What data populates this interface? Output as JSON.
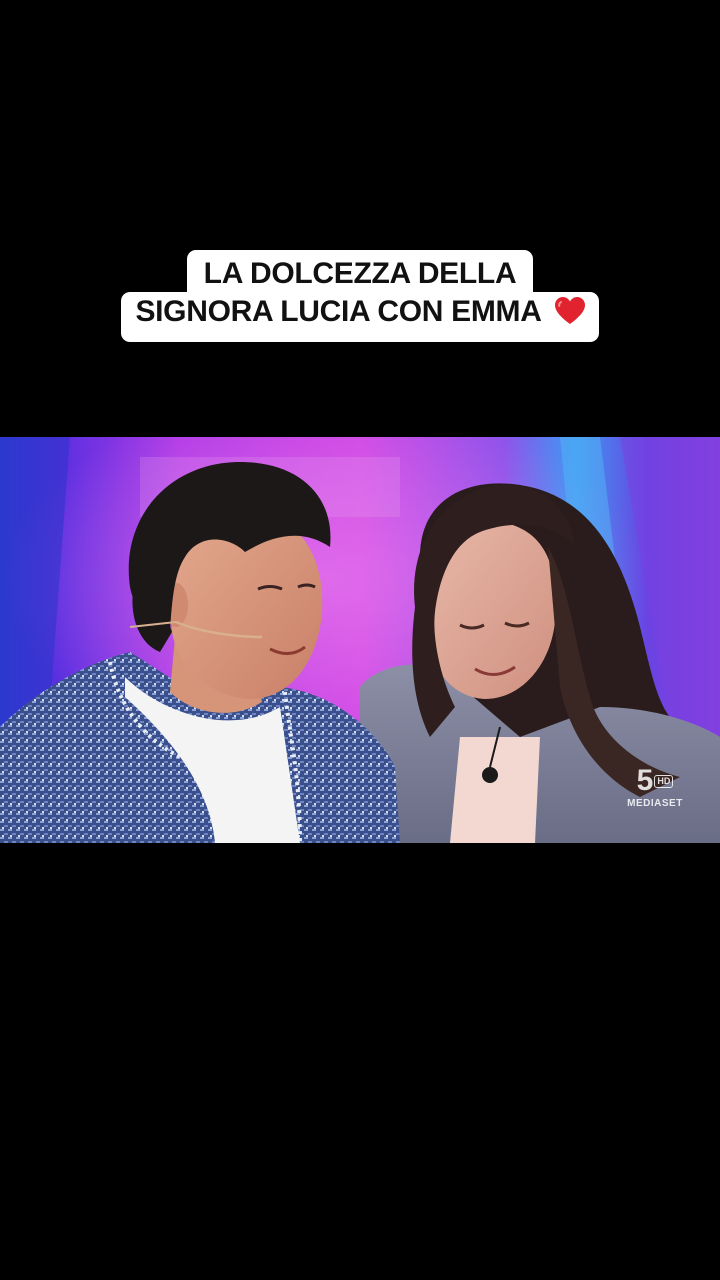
{
  "caption": {
    "line1": "LA DOLCEZZA DELLA",
    "line2": "SIGNORA LUCIA CON EMMA",
    "emoji": "❤️"
  },
  "video": {
    "logo": {
      "mark": "5",
      "badge": "HD",
      "name": "MEDIASET"
    }
  },
  "colors": {
    "background": "#000000",
    "caption_bg": "#ffffff",
    "caption_text": "#111111",
    "heart": "#e0232e"
  },
  "icons": [
    "heart-emoji-icon",
    "channel-logo-icon"
  ]
}
